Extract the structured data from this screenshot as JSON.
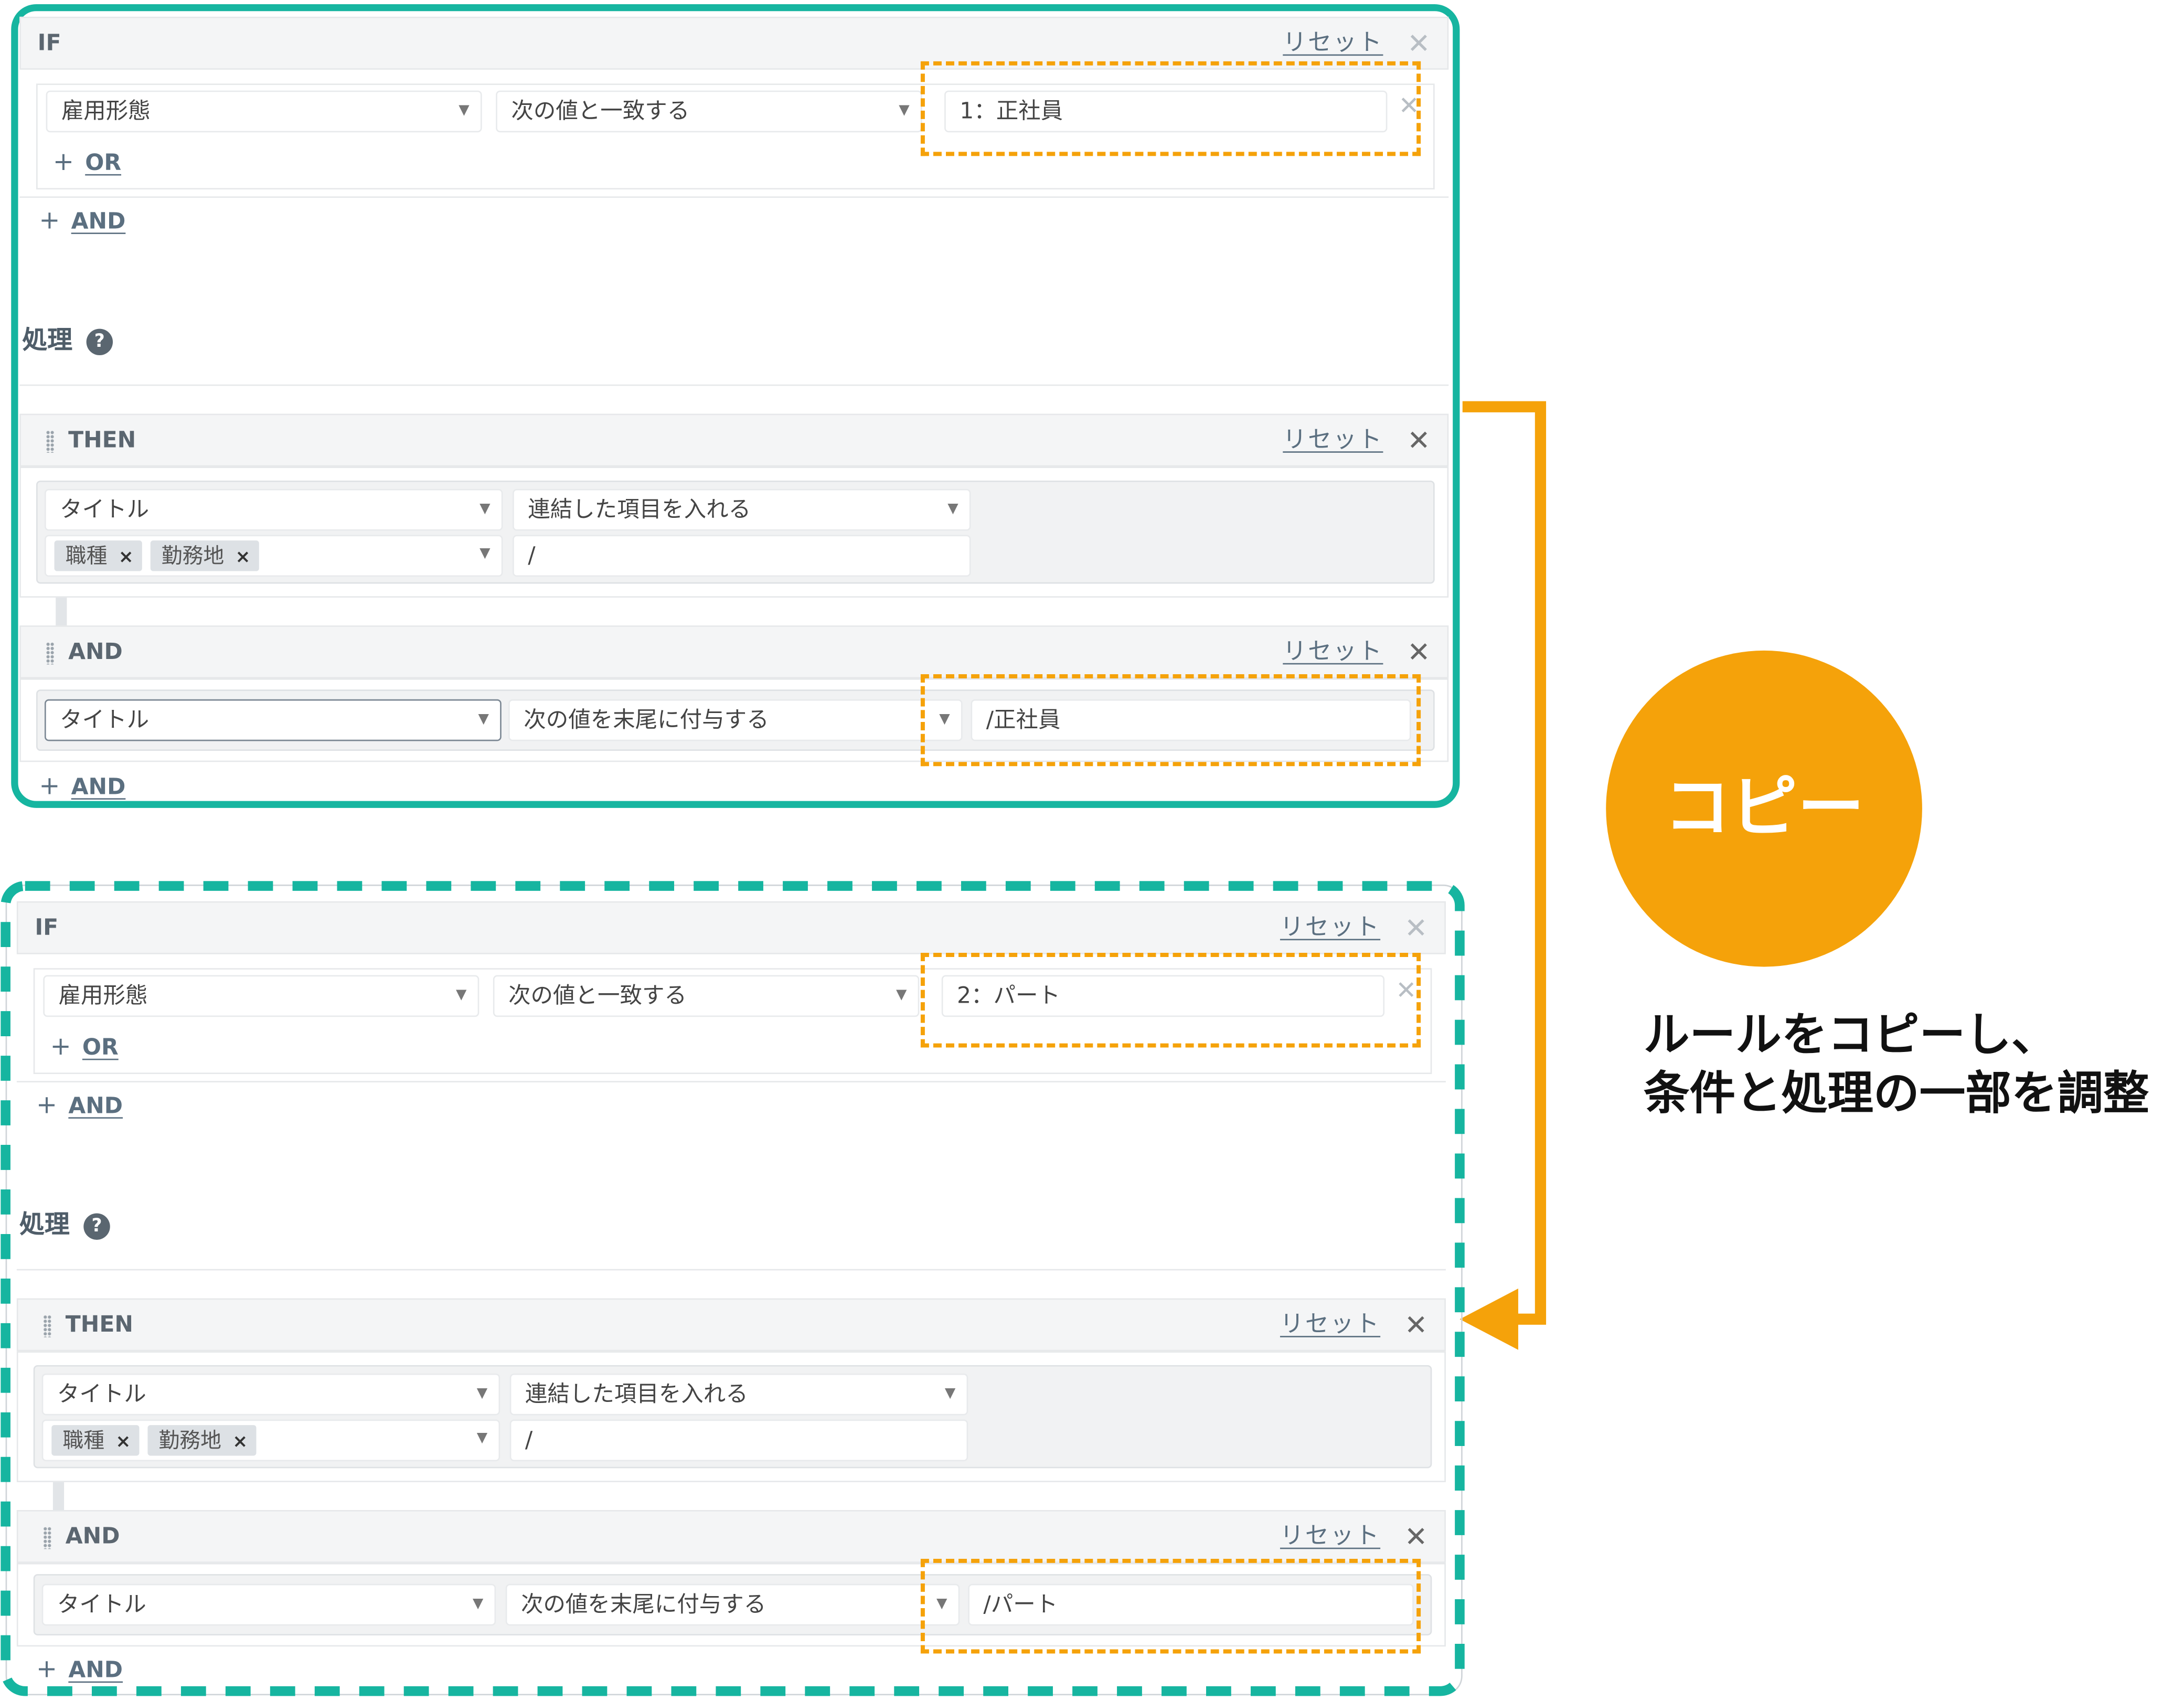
{
  "colors": {
    "teal": "#16b5a0",
    "orange": "#f5a20a"
  },
  "rule1": {
    "if_label": "IF",
    "reset": "リセット",
    "cond_field": "雇用形態",
    "cond_op": "次の値と一致する",
    "cond_value": "1：正社員",
    "or_label": "OR",
    "and_label": "AND",
    "section_title": "処理",
    "then_label": "THEN",
    "then_field": "タイトル",
    "then_op": "連結した項目を入れる",
    "tags": [
      "職種",
      "勤務地"
    ],
    "separator": "/",
    "and2_label": "AND",
    "and2_field": "タイトル",
    "and2_op": "次の値を末尾に付与する",
    "and2_value": "/正社員",
    "add_and": "AND"
  },
  "rule2": {
    "if_label": "IF",
    "reset": "リセット",
    "cond_field": "雇用形態",
    "cond_op": "次の値と一致する",
    "cond_value": "2：パート",
    "or_label": "OR",
    "and_label": "AND",
    "section_title": "処理",
    "then_label": "THEN",
    "then_field": "タイトル",
    "then_op": "連結した項目を入れる",
    "tags": [
      "職種",
      "勤務地"
    ],
    "separator": "/",
    "and2_label": "AND",
    "and2_field": "タイトル",
    "and2_op": "次の値を末尾に付与する",
    "and2_value": "/パート",
    "add_and": "AND"
  },
  "copy_badge": "コピー",
  "caption_line1": "ルールをコピーし、",
  "caption_line2": "条件と処理の一部を調整"
}
